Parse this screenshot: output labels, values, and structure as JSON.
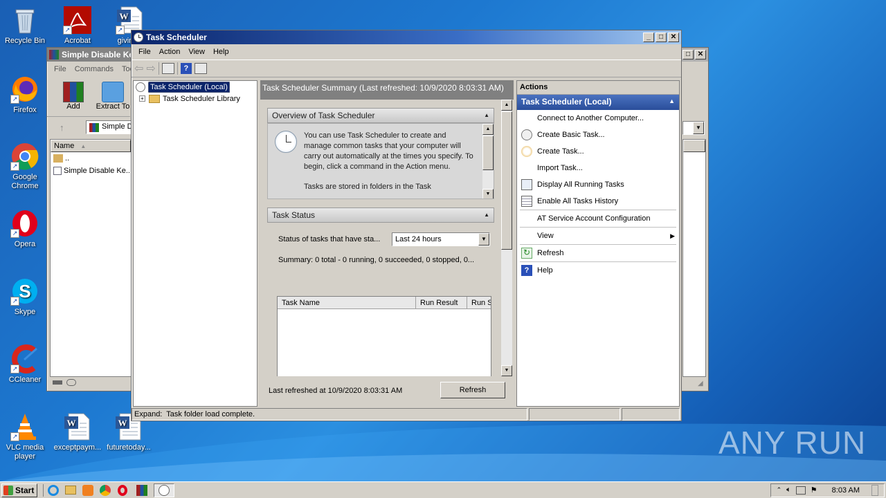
{
  "desktop": {
    "icons": {
      "recycle": "Recycle Bin",
      "acrobat": "Acrobat",
      "giving": "givingw",
      "firefox": "Firefox",
      "chrome": "Google Chrome",
      "opera": "Opera",
      "skype": "Skype",
      "ccleaner": "CCleaner",
      "vlc": "VLC media player",
      "doc1": "exceptpaym...",
      "doc2": "futuretoday..."
    },
    "watermark": "ANY RUN"
  },
  "winrar": {
    "title": "Simple Disable Ke",
    "menu": [
      "File",
      "Commands",
      "Too"
    ],
    "toolbar": {
      "add": "Add",
      "extract": "Extract To"
    },
    "address": "Simple D",
    "column_name": "Name",
    "rows": [
      "..",
      "Simple Disable Ke..."
    ]
  },
  "ts": {
    "title": "Task Scheduler",
    "menu": [
      "File",
      "Action",
      "View",
      "Help"
    ],
    "tree": {
      "root": "Task Scheduler (Local)",
      "child": "Task Scheduler Library"
    },
    "summary_header": "Task Scheduler Summary (Last refreshed: 10/9/2020 8:03:31 AM)",
    "overview": {
      "header": "Overview of Task Scheduler",
      "text": "You can use Task Scheduler to create and manage common tasks that your computer will carry out automatically at the times you specify. To begin, click a command in the Action menu.",
      "text2": "Tasks are stored in folders in the Task"
    },
    "status": {
      "header": "Task Status",
      "label": "Status of tasks that have sta...",
      "select": "Last 24 hours",
      "summary": "Summary: 0 total - 0 running, 0 succeeded, 0 stopped, 0...",
      "columns": [
        "Task Name",
        "Run Result",
        "Run S"
      ]
    },
    "last_refreshed": "Last refreshed at 10/9/2020 8:03:31 AM",
    "refresh_button": "Refresh",
    "actions": {
      "header": "Actions",
      "section": "Task Scheduler (Local)",
      "items": [
        "Connect to Another Computer...",
        "Create Basic Task...",
        "Create Task...",
        "Import Task...",
        "Display All Running Tasks",
        "Enable All Tasks History",
        "AT Service Account Configuration",
        "View",
        "Refresh",
        "Help"
      ]
    },
    "statusbar": "Expand:  Task folder load complete."
  },
  "taskbar": {
    "start": "Start",
    "clock": "8:03 AM"
  }
}
